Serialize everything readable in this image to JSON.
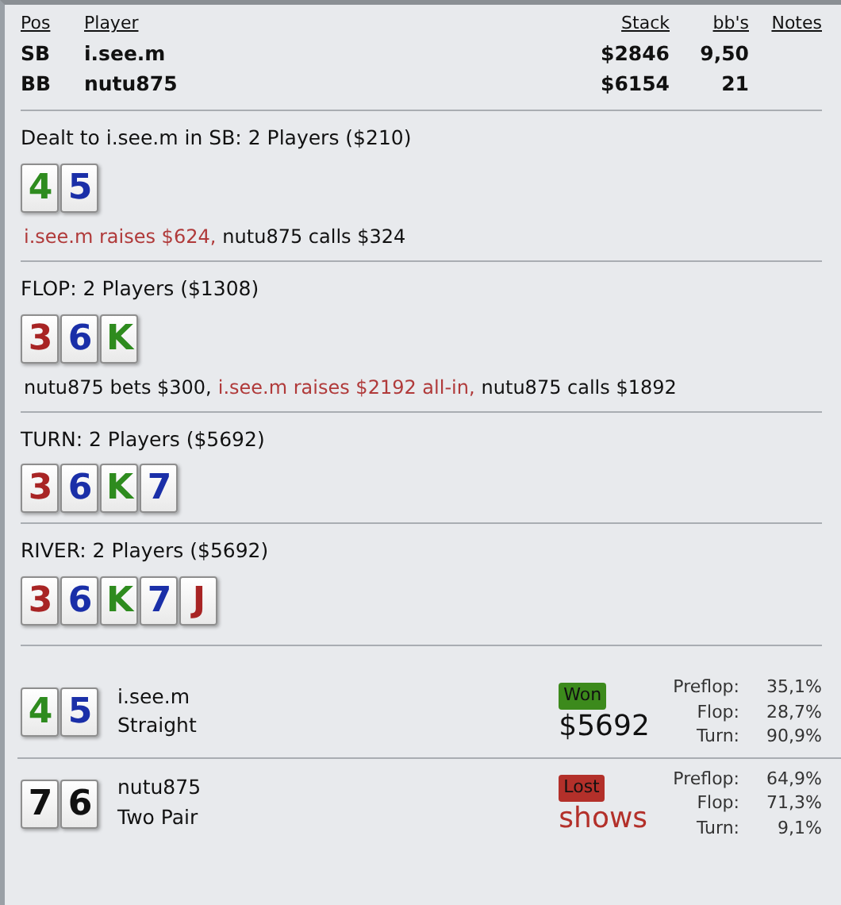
{
  "players_table": {
    "columns": [
      "Pos",
      "Player",
      "Stack",
      "bb's",
      "Notes"
    ],
    "rows": [
      {
        "pos": "SB",
        "player": "i.see.m",
        "stack": "$2846",
        "bbs": "9,50"
      },
      {
        "pos": "BB",
        "player": "nutu875",
        "stack": "$6154",
        "bbs": "21"
      }
    ]
  },
  "streets": [
    {
      "title": "Dealt to i.see.m in SB: 2 Players ($210)",
      "cards": [
        {
          "rank": "4",
          "color": "#2e8b1e"
        },
        {
          "rank": "5",
          "color": "#1a2fa8"
        }
      ],
      "actions": [
        {
          "text": "i.see.m raises $624,",
          "highlight": true
        },
        {
          "text": "nutu875 calls $324",
          "highlight": false
        }
      ]
    },
    {
      "title": "FLOP: 2 Players ($1308)",
      "cards": [
        {
          "rank": "3",
          "color": "#a82424"
        },
        {
          "rank": "6",
          "color": "#1a2fa8"
        },
        {
          "rank": "K",
          "color": "#2e8b1e"
        }
      ],
      "actions": [
        {
          "text": "nutu875 bets $300,",
          "highlight": false
        },
        {
          "text": "i.see.m raises $2192 all-in,",
          "highlight": true
        },
        {
          "text": "nutu875 calls $1892",
          "highlight": false
        }
      ]
    },
    {
      "title": "TURN: 2 Players ($5692)",
      "cards": [
        {
          "rank": "3",
          "color": "#a82424"
        },
        {
          "rank": "6",
          "color": "#1a2fa8"
        },
        {
          "rank": "K",
          "color": "#2e8b1e"
        },
        {
          "rank": "7",
          "color": "#1a2fa8"
        }
      ]
    },
    {
      "title": "RIVER: 2 Players ($5692)",
      "cards": [
        {
          "rank": "3",
          "color": "#a82424"
        },
        {
          "rank": "6",
          "color": "#1a2fa8"
        },
        {
          "rank": "K",
          "color": "#2e8b1e"
        },
        {
          "rank": "7",
          "color": "#1a2fa8"
        },
        {
          "rank": "J",
          "color": "#a82424"
        }
      ]
    }
  ],
  "results": [
    {
      "cards": [
        {
          "rank": "4",
          "color": "#2e8b1e"
        },
        {
          "rank": "5",
          "color": "#1a2fa8"
        }
      ],
      "player": "i.see.m",
      "hand": "Straight",
      "kind": "won",
      "badge": "Won",
      "amount": "$5692",
      "equity": [
        {
          "label": "Preflop:",
          "value": "35,1%"
        },
        {
          "label": "Flop:",
          "value": "28,7%"
        },
        {
          "label": "Turn:",
          "value": "90,9%"
        }
      ]
    },
    {
      "cards": [
        {
          "rank": "7",
          "color": "#111111"
        },
        {
          "rank": "6",
          "color": "#111111"
        }
      ],
      "player": "nutu875",
      "hand": "Two Pair",
      "kind": "lost",
      "badge": "Lost",
      "amount": "shows",
      "equity": [
        {
          "label": "Preflop:",
          "value": "64,9%"
        },
        {
          "label": "Flop:",
          "value": "71,3%"
        },
        {
          "label": "Turn:",
          "value": "9,1%"
        }
      ]
    }
  ]
}
